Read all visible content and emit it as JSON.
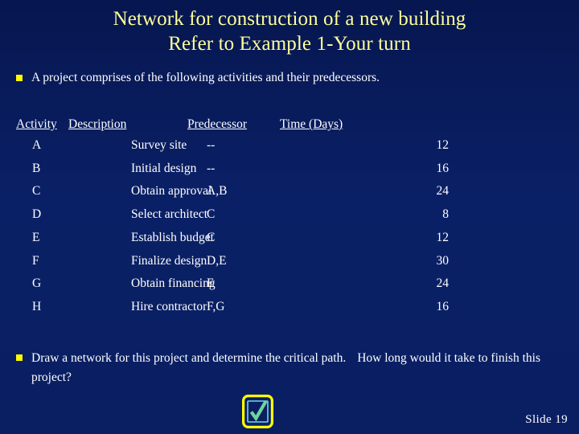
{
  "slide": {
    "background_color": "#0A2066",
    "title_color": "#FFFF99",
    "body_text_color": "#FFFFFF",
    "bullet_color": "#FFFF00",
    "title": {
      "line1": "Network for construction of a new building",
      "line2": "Refer to Example 1-Your turn"
    },
    "intro_bullet": "A project comprises of the following activities and their predecessors.",
    "closing_bullet_part1": "Draw a network for this project and determine the critical path.",
    "closing_bullet_part2": "How long would it take to finish this project?",
    "slide_number_label": "Slide  19",
    "check_icon_name": "check-box-icon"
  },
  "table": {
    "headers": [
      "Activity",
      "Description",
      "Predecessor",
      "Time (Days)"
    ],
    "rows": [
      {
        "activity": "A",
        "description": "Survey site",
        "predecessor": "--",
        "time": "12"
      },
      {
        "activity": "B",
        "description": "Initial design",
        "predecessor": "--",
        "time": "16"
      },
      {
        "activity": "C",
        "description": "Obtain approval",
        "predecessor": "A,B",
        "time": "24"
      },
      {
        "activity": "D",
        "description": "Select architect",
        "predecessor": "C",
        "time": "8"
      },
      {
        "activity": "E",
        "description": "Establish budget",
        "predecessor": "C",
        "time": "12"
      },
      {
        "activity": "F",
        "description": "Finalize design",
        "predecessor": "D,E",
        "time": "30"
      },
      {
        "activity": "G",
        "description": "Obtain financing",
        "predecessor": "E",
        "time": "24"
      },
      {
        "activity": "H",
        "description": "Hire contractor",
        "predecessor": "F,G",
        "time": "16"
      }
    ]
  }
}
